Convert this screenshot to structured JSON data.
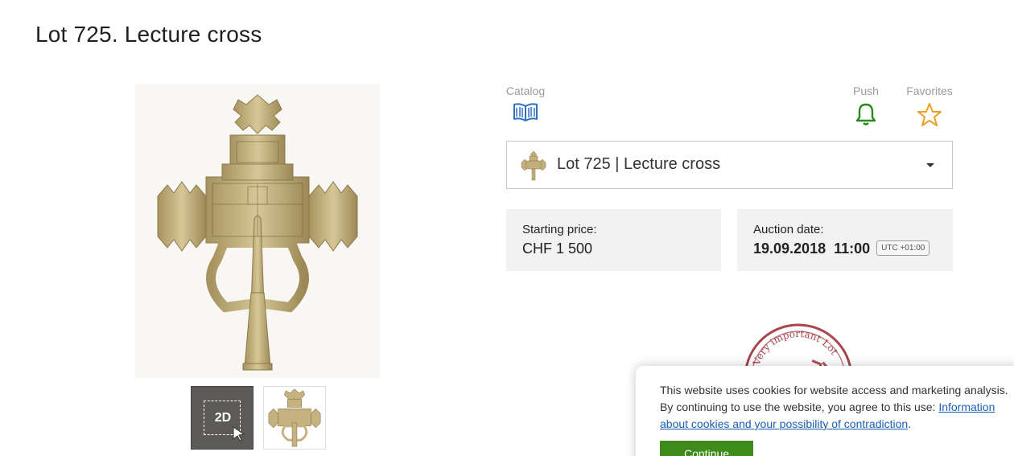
{
  "page": {
    "title": "Lot 725. Lecture cross"
  },
  "gallery": {
    "thumb_2d_label": "2D"
  },
  "toolbar": {
    "catalog_label": "Catalog",
    "push_label": "Push",
    "favorites_label": "Favorites",
    "icons": {
      "catalog": "book-icon",
      "push": "bell-icon",
      "favorites": "star-icon"
    },
    "colors": {
      "catalog": "#2e6fbf",
      "push": "#2a8a1d",
      "favorites": "#f0a020"
    }
  },
  "lot_select": {
    "value": "Lot 725 | Lecture cross"
  },
  "price": {
    "label": "Starting price:",
    "value": "CHF 1 500"
  },
  "auction": {
    "label": "Auction date:",
    "date": "19.09.2018",
    "time": "11:00",
    "tz": "UTC +01:00"
  },
  "stamp": {
    "text": "Very important Lot"
  },
  "cookie": {
    "text": "This website uses cookies for website access and marketing analysis. By continuing to use the website, you agree to this use: ",
    "link": "Information about cookies and your possibility of contradiction",
    "suffix": ".",
    "button": "Continue",
    "button_color": "#3e8a1a"
  }
}
